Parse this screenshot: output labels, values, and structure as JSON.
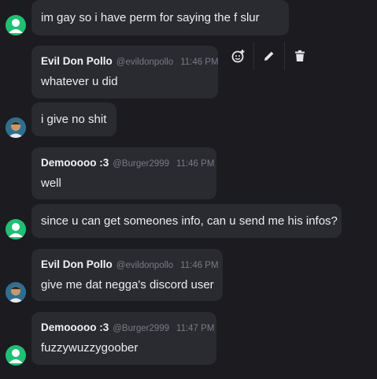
{
  "top_partial": {
    "text": "@"
  },
  "messages": [
    {
      "body": "im gay so i have perm for saying the f slur"
    },
    {
      "name": "Evil Don Pollo",
      "handle": "@evildonpollo",
      "time": "11:46 PM",
      "body": "whatever u did"
    },
    {
      "body": "i give no shit"
    },
    {
      "name": "Demooooo :3",
      "handle": "@Burger2999",
      "time": "11:46 PM",
      "body": "well"
    },
    {
      "body": "since u can get someones info, can u send me his infos?"
    },
    {
      "name": "Evil Don Pollo",
      "handle": "@evildonpollo",
      "time": "11:46 PM",
      "body": "give me dat negga's discord user"
    },
    {
      "name": "Demooooo :3",
      "handle": "@Burger2999",
      "time": "11:47 PM",
      "body": "fuzzywuzzygoober"
    }
  ],
  "toolbar": {
    "icons": [
      "add-reaction-icon",
      "edit-icon",
      "delete-icon"
    ]
  },
  "colors": {
    "background": "#1b1b20",
    "bubble": "#2a2a31",
    "avatar_green": "#1fbf74",
    "muted": "#7a7a85"
  }
}
